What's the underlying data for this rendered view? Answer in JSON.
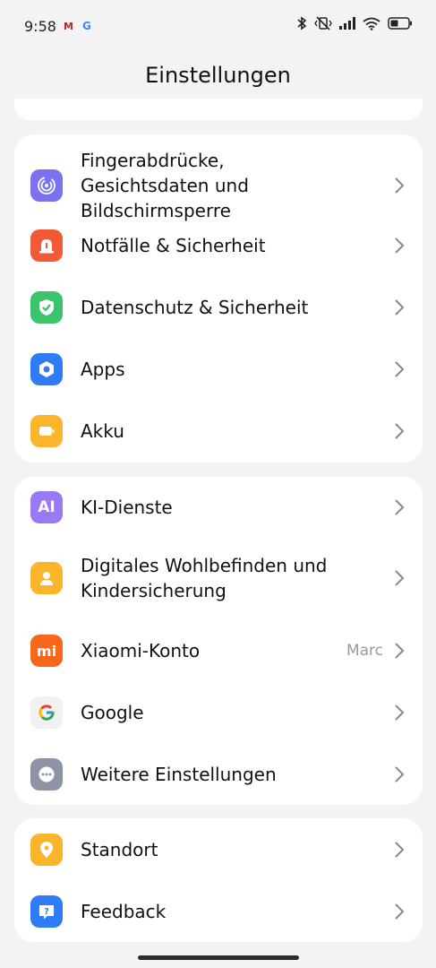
{
  "status_bar": {
    "time": "9:58",
    "notif_gmail": "M",
    "notif_google": "G",
    "icons": [
      "bluetooth-icon",
      "vibrate-off-icon",
      "signal-icon",
      "wifi-icon",
      "battery-icon"
    ]
  },
  "header": {
    "title": "Einstellungen"
  },
  "groups": [
    {
      "items": [
        {
          "label": "Fingerabdrücke, Gesichtsdaten und Bildschirmsperre",
          "icon": "fingerprint-icon",
          "color": "#7b72f0"
        },
        {
          "label": "Notfälle & Sicherheit",
          "icon": "emergency-bell-icon",
          "color": "#f25a35"
        },
        {
          "label": "Datenschutz & Sicherheit",
          "icon": "shield-check-icon",
          "color": "#3cc46a"
        },
        {
          "label": "Apps",
          "icon": "apps-hexagon-icon",
          "color": "#2f7cf6"
        },
        {
          "label": "Akku",
          "icon": "battery-icon",
          "color": "#fbb52a"
        }
      ]
    },
    {
      "items": [
        {
          "label": "KI-Dienste",
          "icon": "ai-icon",
          "icon_text": "AI",
          "color": "#9a79f5"
        },
        {
          "label": "Digitales Wohlbefinden und Kindersicherung",
          "icon": "wellbeing-person-icon",
          "color": "#fbb52a"
        },
        {
          "label": "Xiaomi-Konto",
          "value": "Marc",
          "icon": "xiaomi-logo-icon",
          "icon_text": "mi",
          "color": "#f8671c"
        },
        {
          "label": "Google",
          "icon": "google-logo-icon",
          "color": "#f1f1f1"
        },
        {
          "label": "Weitere Einstellungen",
          "icon": "more-dots-icon",
          "color": "#8e93a6"
        }
      ]
    },
    {
      "items": [
        {
          "label": "Standort",
          "icon": "location-pin-icon",
          "color": "#fbb52a"
        },
        {
          "label": "Feedback",
          "icon": "feedback-icon",
          "color": "#2f7cf6"
        }
      ]
    }
  ]
}
